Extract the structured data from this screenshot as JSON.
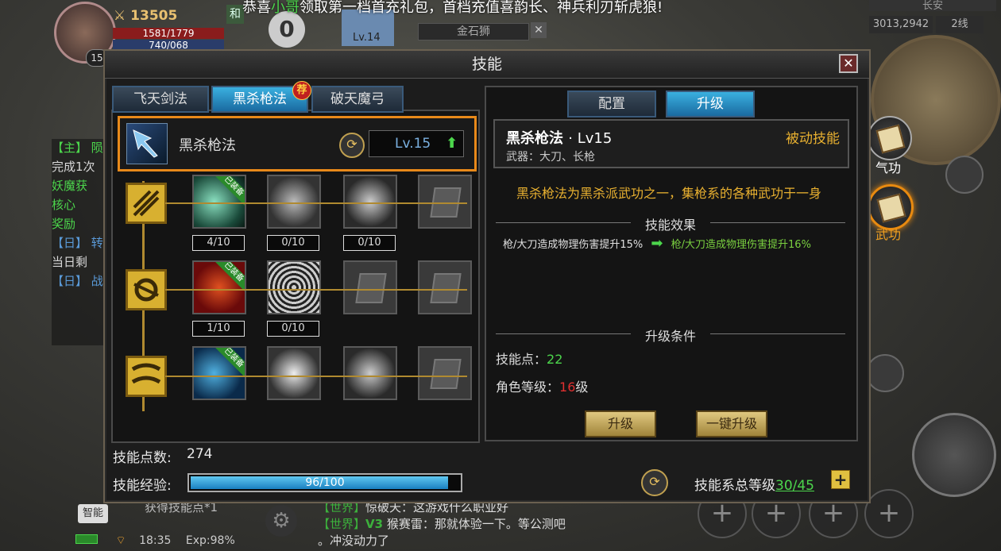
{
  "hud": {
    "power": "13505",
    "hp": "1581/1779",
    "mp": "740/068",
    "level": "15",
    "badge": "和",
    "score": "0",
    "ally_level": "Lv.14",
    "target_name": "金石狮",
    "target_close": "✕"
  },
  "announcement": {
    "pre": "恭喜",
    "name": "小哥",
    "post": "领取第一档首充礼包，首档充值喜韵长、神兵利刃斩虎狼!"
  },
  "minimap": {
    "city": "长安",
    "coords": "3013,2942",
    "line": "2线"
  },
  "side_menu": [
    {
      "label": "气功",
      "active": false
    },
    {
      "label": "武功",
      "active": true
    }
  ],
  "quest_log": [
    "【主】 陨",
    "完成1次",
    "妖魔获",
    "核心",
    "奖励",
    "【日】 转",
    "当日剩",
    "【日】 战"
  ],
  "chat": {
    "system_msg": "获得技能点*1",
    "lines": [
      {
        "channel": "【世界】",
        "text": "惊破天：这游戏什么职业好"
      },
      {
        "channel": "【世界】",
        "vip": "V3",
        "text": "猴赛雷：那就体验一下。等公测吧"
      },
      {
        "channel": "",
        "text": "。冲没动力了"
      }
    ]
  },
  "status_bar": {
    "time": "18:35",
    "exp": "Exp:98%"
  },
  "smart_label": "智能",
  "action_slots": [
    "+",
    "+",
    "+",
    "+"
  ],
  "dialog": {
    "title": "技能",
    "close": "✕",
    "tabs": [
      {
        "label": "飞天剑法",
        "active": false
      },
      {
        "label": "黑杀枪法",
        "active": true,
        "badge": "荐"
      },
      {
        "label": "破天魔弓",
        "active": false
      }
    ],
    "selected_skill": {
      "name": "黑杀枪法",
      "level": "Lv.15",
      "arrow": "⬆"
    },
    "equipped_tag": "已装备",
    "skill_rows": [
      {
        "slots": [
          {
            "style": "slot-g1",
            "equipped": true,
            "level": "4/10"
          },
          {
            "style": "slot-g2",
            "equipped": false,
            "level": "0/10"
          },
          {
            "style": "slot-g3",
            "equipped": false,
            "level": "0/10"
          },
          {
            "style": "slot-lock",
            "equipped": false,
            "level": ""
          }
        ]
      },
      {
        "slots": [
          {
            "style": "slot-r",
            "equipped": true,
            "level": "1/10"
          },
          {
            "style": "slot-v",
            "equipped": false,
            "level": "0/10"
          },
          {
            "style": "slot-lock",
            "equipped": false,
            "level": ""
          },
          {
            "style": "slot-lock",
            "equipped": false,
            "level": ""
          }
        ]
      },
      {
        "slots": [
          {
            "style": "slot-b",
            "equipped": true,
            "level": ""
          },
          {
            "style": "slot-w",
            "equipped": false,
            "level": ""
          },
          {
            "style": "slot-g3",
            "equipped": false,
            "level": ""
          },
          {
            "style": "slot-lock",
            "equipped": false,
            "level": ""
          }
        ]
      }
    ],
    "skill_points_label": "技能点数:",
    "skill_points_value": "274",
    "skill_exp_label": "技能经验:",
    "skill_exp_text": "96/100",
    "skill_exp_fraction": 0.96,
    "total_level_label": "技能系总等级",
    "total_level_value": "30/45",
    "right_tabs": [
      {
        "label": "配置",
        "active": false
      },
      {
        "label": "升级",
        "active": true
      }
    ],
    "detail": {
      "name": "黑杀枪法",
      "level": "· Lv15",
      "type": "被动技能",
      "weapon": "武器：大刀、长枪",
      "description": "黑杀枪法为黑杀派武功之一，集枪系的各种武功于一身",
      "effect_title": "技能效果",
      "effect_from": "枪/大刀造成物理伤害提升15%",
      "effect_arrow": "➡",
      "effect_to": "枪/大刀造成物理伤害提升16%",
      "cond_title": "升级条件",
      "cond_points_label": "技能点：",
      "cond_points_value": "22",
      "cond_level_label": "角色等级：",
      "cond_level_value": "16",
      "cond_level_unit": "级",
      "upgrade_btn": "升级",
      "upgrade_all_btn": "一键升级"
    }
  },
  "colors": {
    "accent_orange": "#e8891a",
    "tab_active": "#3ab0e0",
    "green": "#4cd64c",
    "gold": "#e8b030",
    "red": "#e03030"
  }
}
